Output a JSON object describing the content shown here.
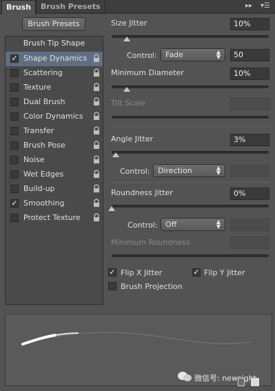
{
  "tabs": {
    "active": "Brush",
    "inactive": "Brush Presets",
    "collapse_icon": "double-chevron-right-icon",
    "menu_icon": "panel-menu-icon"
  },
  "buttons": {
    "brush_presets": "Brush Presets"
  },
  "left_panel": {
    "header": "Brush Tip Shape",
    "items": [
      {
        "label": "Shape Dynamics",
        "checked": true,
        "selected": true
      },
      {
        "label": "Scattering",
        "checked": false
      },
      {
        "label": "Texture",
        "checked": false
      },
      {
        "label": "Dual Brush",
        "checked": false
      },
      {
        "label": "Color Dynamics",
        "checked": false
      },
      {
        "label": "Transfer",
        "checked": false
      },
      {
        "label": "Brush Pose",
        "checked": false
      },
      {
        "label": "Noise",
        "checked": false
      },
      {
        "label": "Wet Edges",
        "checked": false
      },
      {
        "label": "Build-up",
        "checked": false
      },
      {
        "label": "Smoothing",
        "checked": true
      },
      {
        "label": "Protect Texture",
        "checked": false
      }
    ]
  },
  "size_jitter": {
    "label": "Size Jitter",
    "value": "10%",
    "control_label": "Control:",
    "control_value": "Fade",
    "fade_value": "50"
  },
  "minimum_diameter": {
    "label": "Minimum Diameter",
    "value": "10%"
  },
  "tilt_scale": {
    "label": "Tilt Scale",
    "value": ""
  },
  "angle_jitter": {
    "label": "Angle Jitter",
    "value": "3%",
    "control_label": "Control:",
    "control_value": "Direction"
  },
  "roundness_jitter": {
    "label": "Roundness Jitter",
    "value": "0%",
    "control_label": "Control:",
    "control_value": "Off"
  },
  "minimum_roundness": {
    "label": "Minimum Roundness",
    "value": ""
  },
  "options": {
    "flip_x": {
      "label": "Flip X Jitter",
      "checked": true
    },
    "flip_y": {
      "label": "Flip Y Jitter",
      "checked": true
    },
    "brush_projection": {
      "label": "Brush Projection",
      "checked": false
    }
  },
  "preview_icons": {
    "new_preset": "new-brush-preset-icon",
    "toggle": "toggle-preview-icon"
  },
  "watermark": "微信号: newsight"
}
